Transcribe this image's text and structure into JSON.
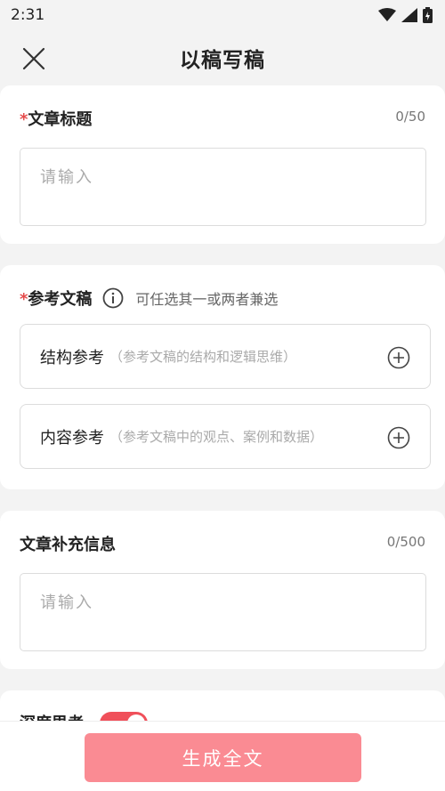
{
  "status_bar": {
    "time": "2:31",
    "icons": [
      "wifi-icon",
      "signal-icon",
      "battery-icon"
    ]
  },
  "header": {
    "title": "以稿写稿",
    "close_icon": "close-icon"
  },
  "article_title": {
    "required_mark": "*",
    "label": "文章标题",
    "counter": "0/50",
    "placeholder": "请输入"
  },
  "reference": {
    "required_mark": "*",
    "label": "参考文稿",
    "info_icon": "info-icon",
    "info_text": "可任选其一或两者兼选",
    "items": [
      {
        "label": "结构参考",
        "hint": "（参考文稿的结构和逻辑思维）",
        "icon": "add-circle-icon"
      },
      {
        "label": "内容参考",
        "hint": "（参考文稿中的观点、案例和数据）",
        "icon": "add-circle-icon"
      }
    ]
  },
  "supplement": {
    "label": "文章补充信息",
    "counter": "0/500",
    "placeholder": "请输入"
  },
  "deep_thinking": {
    "label": "深度思考",
    "toggle_on": true
  },
  "footer": {
    "generate_label": "生成全文"
  },
  "colors": {
    "accent": "#fa8b93",
    "required": "#e54b4b",
    "toggle": "#f0505a"
  }
}
